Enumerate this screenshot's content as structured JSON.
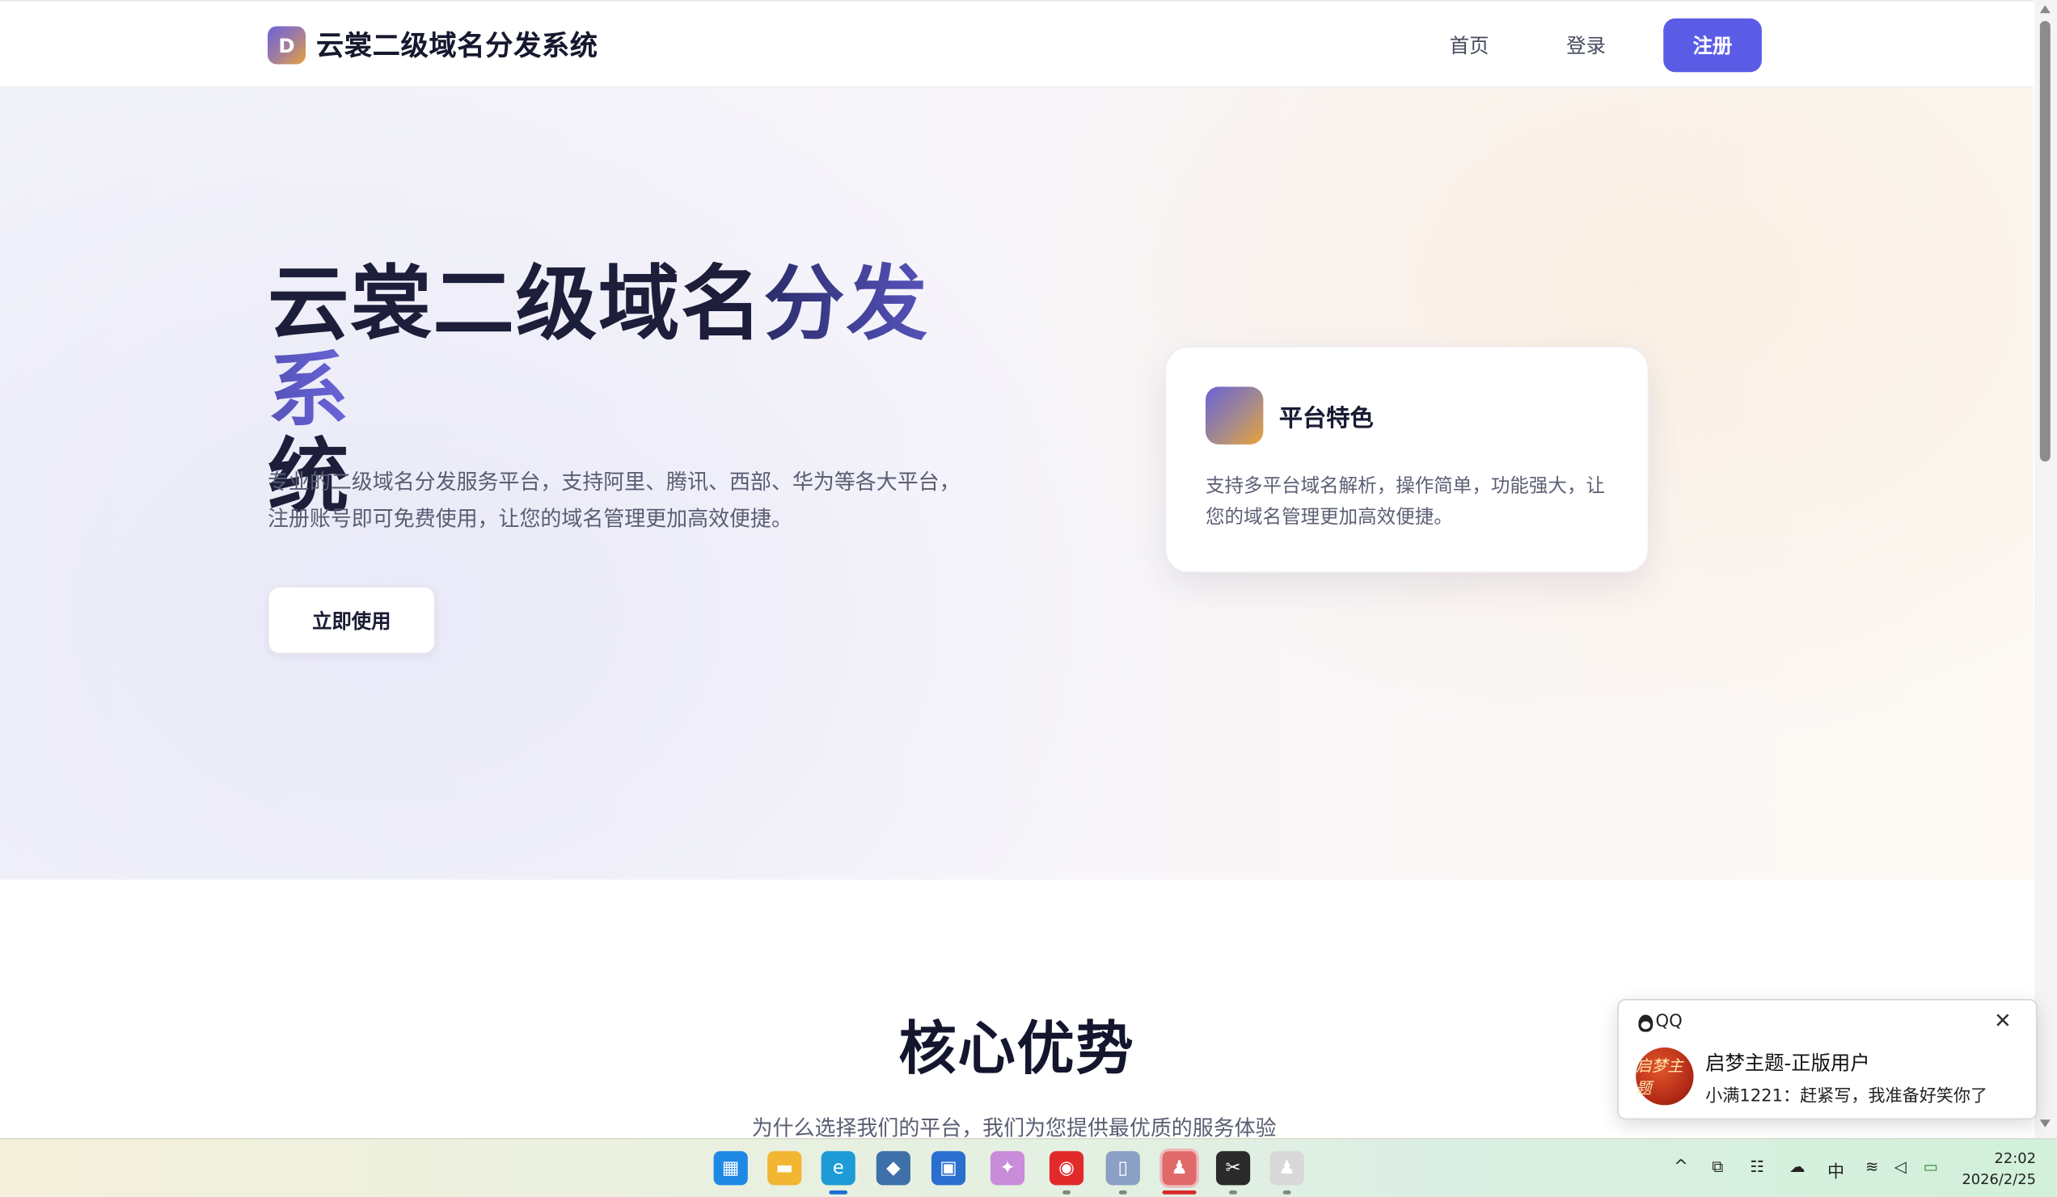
{
  "header": {
    "logo_letter": "D",
    "site_name": "云裳二级域名分发系统",
    "nav": {
      "home": "首页",
      "login": "登录",
      "register": "注册"
    }
  },
  "hero": {
    "title_part1": "云裳二级域名",
    "title_part2": "分发系",
    "title_part3": "统",
    "description": "专业的二级域名分发服务平台，支持阿里、腾讯、西部、华为等各大平台，注册账号即可免费使用，让您的域名管理更加高效便捷。",
    "cta_label": "立即使用"
  },
  "feature_card": {
    "title": "平台特色",
    "description": "支持多平台域名解析，操作简单，功能强大，让您的域名管理更加高效便捷。"
  },
  "advantages": {
    "title": "核心优势",
    "subtitle": "为什么选择我们的平台，我们为您提供最优质的服务体验"
  },
  "notification": {
    "app_name": "QQ",
    "close_glyph": "✕",
    "avatar_text": "启梦主题",
    "title": "启梦主题-正版用户",
    "message": "小满1221：赶紧写，我准备好笑你了"
  },
  "taskbar": {
    "apps": [
      {
        "name": "start-icon",
        "color": "#1e88e5",
        "glyph": "▦"
      },
      {
        "name": "file-explorer-icon",
        "color": "#f2b632",
        "glyph": "▬"
      },
      {
        "name": "edge-icon",
        "color": "#1d9bd6",
        "glyph": "e"
      },
      {
        "name": "app-blue-icon",
        "color": "#3e6fa8",
        "glyph": "◆"
      },
      {
        "name": "microsoft-store-icon",
        "color": "#2a6fd0",
        "glyph": "▣"
      },
      {
        "name": "copilot-icon",
        "color": "#c88cd8",
        "glyph": "✦"
      },
      {
        "name": "netease-music-icon",
        "color": "#e22a2a",
        "glyph": "◉"
      },
      {
        "name": "phone-link-icon",
        "color": "#8aa0c4",
        "glyph": "▯"
      },
      {
        "name": "qq-icon",
        "color": "#e06a6a",
        "glyph": "♟"
      },
      {
        "name": "capcut-icon",
        "color": "#2a2a2a",
        "glyph": "✂"
      },
      {
        "name": "qq-secondary-icon",
        "color": "#d8d8d8",
        "glyph": "♟"
      }
    ],
    "tray": {
      "chevron": "^",
      "ime": "中",
      "time": "22:02",
      "date": "2026/2/25"
    }
  }
}
